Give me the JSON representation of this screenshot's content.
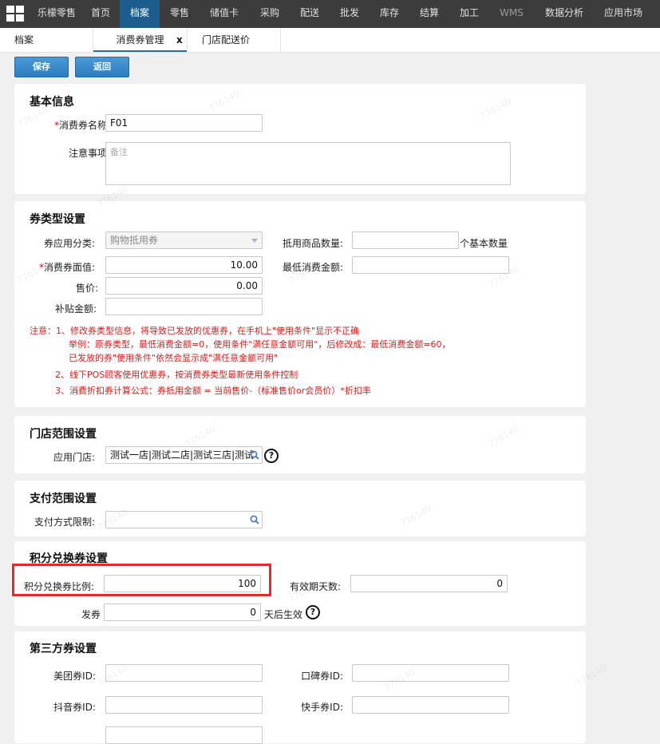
{
  "nav": {
    "items": [
      "乐檬零售",
      "首页",
      "档案",
      "零售",
      "储值卡",
      "采购",
      "配送",
      "批发",
      "库存",
      "结算",
      "加工",
      "WMS",
      "数据分析",
      "应用市场"
    ],
    "active_index": 2
  },
  "tabs": {
    "items": [
      "档案",
      "消费券管理",
      "门店配送价"
    ],
    "active_index": 1,
    "close_label": "x"
  },
  "toolbar": {
    "save_label": "保存",
    "back_label": "返回"
  },
  "basic": {
    "title": "基本信息",
    "name_label": "消费券名称:",
    "name_value": "F01",
    "notes_label": "注意事项:",
    "notes_placeholder": "备注"
  },
  "type_settings": {
    "title": "券类型设置",
    "category_label": "券应用分类:",
    "category_value": "购物抵用券",
    "face_label": "消费券面值:",
    "face_value": "10.00",
    "price_label": "售价:",
    "price_value": "0.00",
    "subsidy_label": "补贴金额:",
    "subsidy_value": "",
    "qty_label": "抵用商品数量:",
    "qty_value": "",
    "qty_suffix": "个基本数量",
    "min_label": "最低消费金额:",
    "min_value": "",
    "notes": [
      "注意：1、修改券类型信息，将导致已发放的优惠券，在手机上\"使用条件\"显示不正确",
      "举例：原券类型，最低消费金额=0，使用条件\"满任意金额可用\"，后修改成：最低消费金额=60，",
      "已发放的券\"使用条件\"依然会显示成\"满任意金额可用\"",
      "2、线下POS顾客使用优惠券，按消费券类型最新使用条件控制",
      "3、消费折扣券计算公式：券抵用金额 = 当前售价-（标准售价or会员价）*折扣率"
    ]
  },
  "store": {
    "title": "门店范围设置",
    "label": "应用门店:",
    "value": "测试一店|测试二店|测试三店|测试"
  },
  "payment": {
    "title": "支付范围设置",
    "label": "支付方式限制:",
    "value": ""
  },
  "points": {
    "title": "积分兑换券设置",
    "ratio_label": "积分兑换券比例:",
    "ratio_value": "100",
    "validity_label": "有效期天数:",
    "validity_value": "0",
    "issue_label": "发券",
    "issue_value": "0",
    "issue_suffix": "天后生效"
  },
  "third_party": {
    "title": "第三方券设置",
    "meituan_label": "美团券ID:",
    "meituan_value": "",
    "koubei_label": "口碑券ID:",
    "koubei_value": "",
    "douyin_label": "抖音券ID:",
    "douyin_value": "",
    "kuaishou_label": "快手券ID:",
    "kuaishou_value": ""
  },
  "watermark": "776140",
  "colors": {
    "nav_bg": "#3c3c3c",
    "nav_active": "#1d5d8e",
    "button": "#2d7cc0",
    "required": "#e00000",
    "highlight": "#e8282c"
  }
}
